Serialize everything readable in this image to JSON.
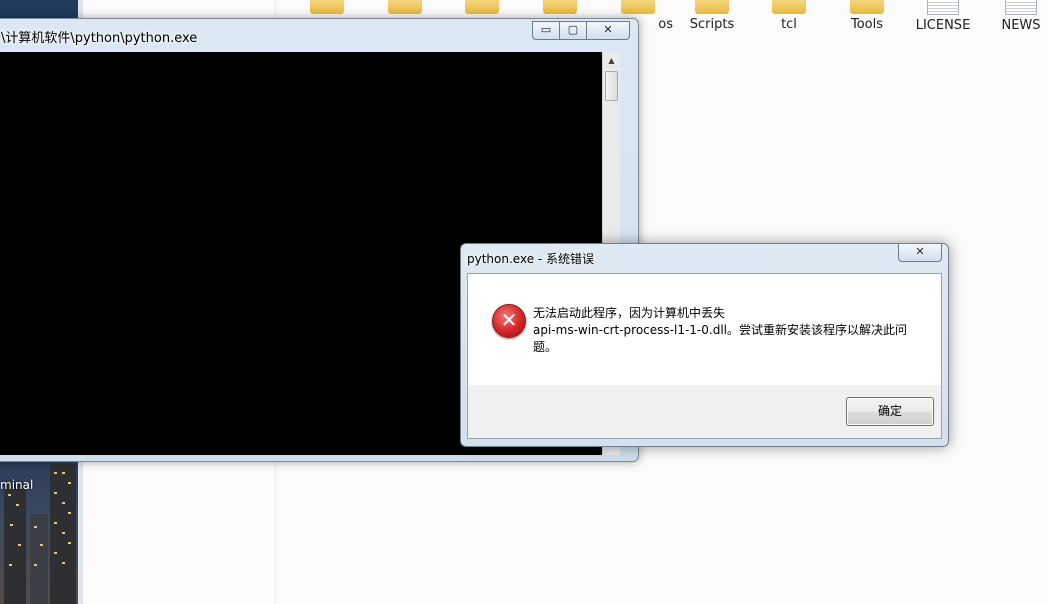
{
  "explorer": {
    "items": [
      {
        "label": "",
        "icon": "folder-icon"
      },
      {
        "label": "",
        "icon": "folder-icon"
      },
      {
        "label": "",
        "icon": "folder-icon"
      },
      {
        "label": "",
        "icon": "folder-icon"
      },
      {
        "label": "os",
        "icon": "folder-icon"
      },
      {
        "label": "Scripts",
        "icon": "folder-icon"
      },
      {
        "label": "tcl",
        "icon": "folder-icon"
      },
      {
        "label": "Tools",
        "icon": "folder-icon"
      },
      {
        "label": "LICENSE",
        "icon": "document-icon"
      },
      {
        "label": "NEWS",
        "icon": "document-icon"
      }
    ]
  },
  "taskbar": {
    "terminal_label": "minal"
  },
  "console": {
    "title": "\\计算机软件\\python\\python.exe",
    "minimize_symbol": "▭",
    "maximize_symbol": "▢",
    "close_symbol": "✕"
  },
  "dialog": {
    "title": "python.exe - 系统错误",
    "close_symbol": "✕",
    "icon": "error-icon",
    "message_lines": [
      "无法启动此程序，因为计算机中丢失",
      "api-ms-win-crt-process-l1-1-0.dll。尝试重新安装该程序以解决此问",
      "题。"
    ],
    "ok_label": "确定"
  }
}
